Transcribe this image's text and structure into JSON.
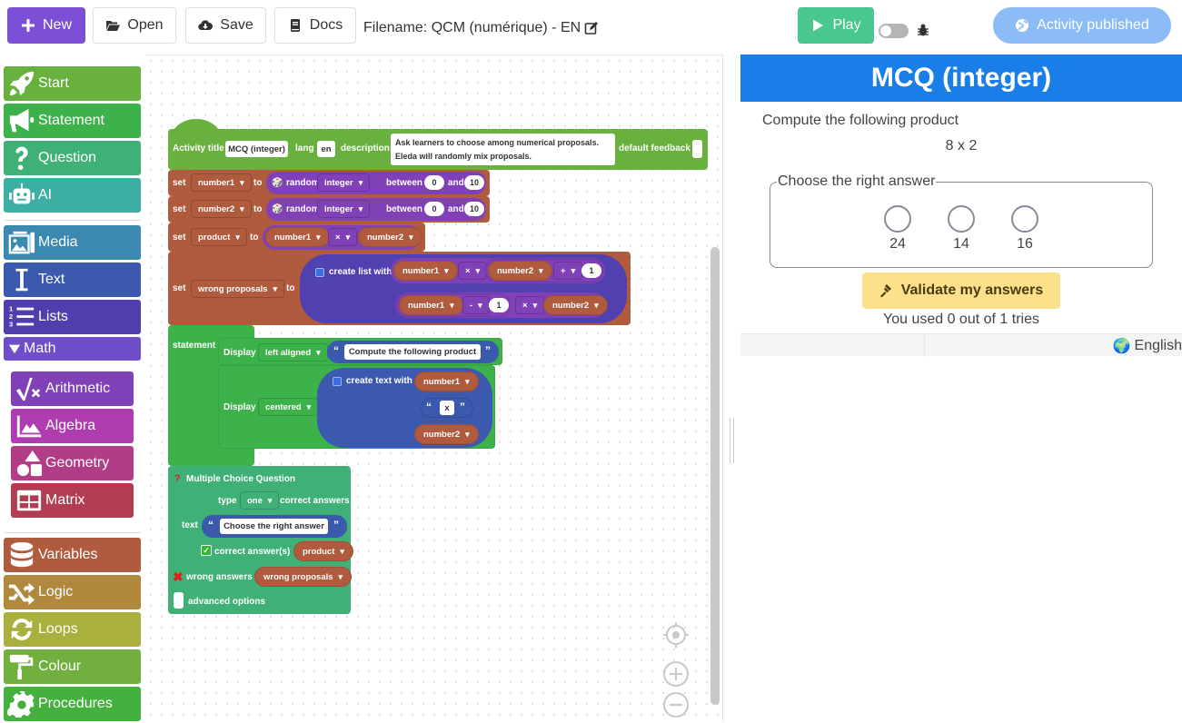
{
  "toolbar": {
    "new_label": "New",
    "open_label": "Open",
    "save_label": "Save",
    "docs_label": "Docs",
    "filename": "Filename: QCM (numérique) - EN",
    "play_label": "Play",
    "published_label": "Activity published"
  },
  "sidebar": {
    "items": [
      {
        "label": "Start",
        "icon": "rocket-icon",
        "color": "#68b13e"
      },
      {
        "label": "Statement",
        "icon": "bullhorn-icon",
        "color": "#3db24a"
      },
      {
        "label": "Question",
        "icon": "question-icon",
        "color": "#3fb076"
      },
      {
        "label": "AI",
        "icon": "robot-icon",
        "color": "#3eafa5"
      },
      {
        "label": "Media",
        "icon": "media-icon",
        "color": "#3b89b0"
      },
      {
        "label": "Text",
        "icon": "text-cursor-icon",
        "color": "#3b5aad"
      },
      {
        "label": "Lists",
        "icon": "list-ol-icon",
        "color": "#4e3eae"
      },
      {
        "label": "Math",
        "icon": "triangle-down-icon",
        "color": "#6e4ec9"
      },
      {
        "label": "Arithmetic",
        "icon": "square-root-icon",
        "color": "#8040b8"
      },
      {
        "label": "Algebra",
        "icon": "chart-area-icon",
        "color": "#b03db0"
      },
      {
        "label": "Geometry",
        "icon": "shapes-icon",
        "color": "#b03d86"
      },
      {
        "label": "Matrix",
        "icon": "table-icon",
        "color": "#b03d52"
      },
      {
        "label": "Variables",
        "icon": "database-icon",
        "color": "#b05a3e"
      },
      {
        "label": "Logic",
        "icon": "shuffle-icon",
        "color": "#b0893e"
      },
      {
        "label": "Loops",
        "icon": "rotate-icon",
        "color": "#a9b03e"
      },
      {
        "label": "Colour",
        "icon": "paint-roller-icon",
        "color": "#71b03e"
      },
      {
        "label": "Procedures",
        "icon": "gear-icon",
        "color": "#45b03e"
      }
    ]
  },
  "blocks": {
    "activity": {
      "title_label": "Activity title",
      "title_value": "MCQ (integer)",
      "lang_label": "lang",
      "lang_value": "en",
      "description_label": "description",
      "description_line1": "Ask learners to choose among numerical proposals.",
      "description_line2": "Eleda will randomly mix proposals.",
      "feedback_label": "default feedback"
    },
    "set_label": "set",
    "to_label": "to",
    "random_label": "random",
    "integer_label": "integer",
    "between_label": "between",
    "and_label": "and",
    "set1": {
      "var": "number1",
      "from": "0",
      "to": "10"
    },
    "set2": {
      "var": "number2",
      "from": "0",
      "to": "10"
    },
    "set3": {
      "var": "product",
      "left": "number1",
      "op": "×",
      "right": "number2"
    },
    "set4": {
      "var": "wrong proposals",
      "create_list_label": "create list with",
      "row1": {
        "a": "number1",
        "op1": "×",
        "b": "number2",
        "op2": "+",
        "c": "1"
      },
      "row2": {
        "a": "number1",
        "op1": "-",
        "b": "1",
        "op2": "×",
        "c": "number2"
      }
    },
    "statement": {
      "label": "statement",
      "display_label": "Display",
      "display1_align": "left aligned",
      "display1_text": "Compute the following product",
      "display2_align": "centered",
      "create_text_label": "create text with",
      "ct_item1": "number1",
      "ct_item2": "x",
      "ct_item3": "number2"
    },
    "mcq": {
      "title": "Multiple Choice Question",
      "type_label": "type",
      "type_value": "one",
      "correct_answers_label": "correct answers",
      "text_label": "text",
      "text_value": "Choose the right answer",
      "correct_label": "correct answer(s)",
      "correct_value": "product",
      "wrong_label": "wrong answers",
      "wrong_value": "wrong proposals",
      "advanced_label": "advanced options"
    }
  },
  "preview": {
    "title": "MCQ (integer)",
    "statement": "Compute the following product",
    "expression": "8 x 2",
    "question": "Choose the right answer",
    "options": [
      "24",
      "14",
      "16"
    ],
    "validate_label": "Validate my answers",
    "tries": "You used 0 out of 1 tries",
    "language": "English"
  }
}
